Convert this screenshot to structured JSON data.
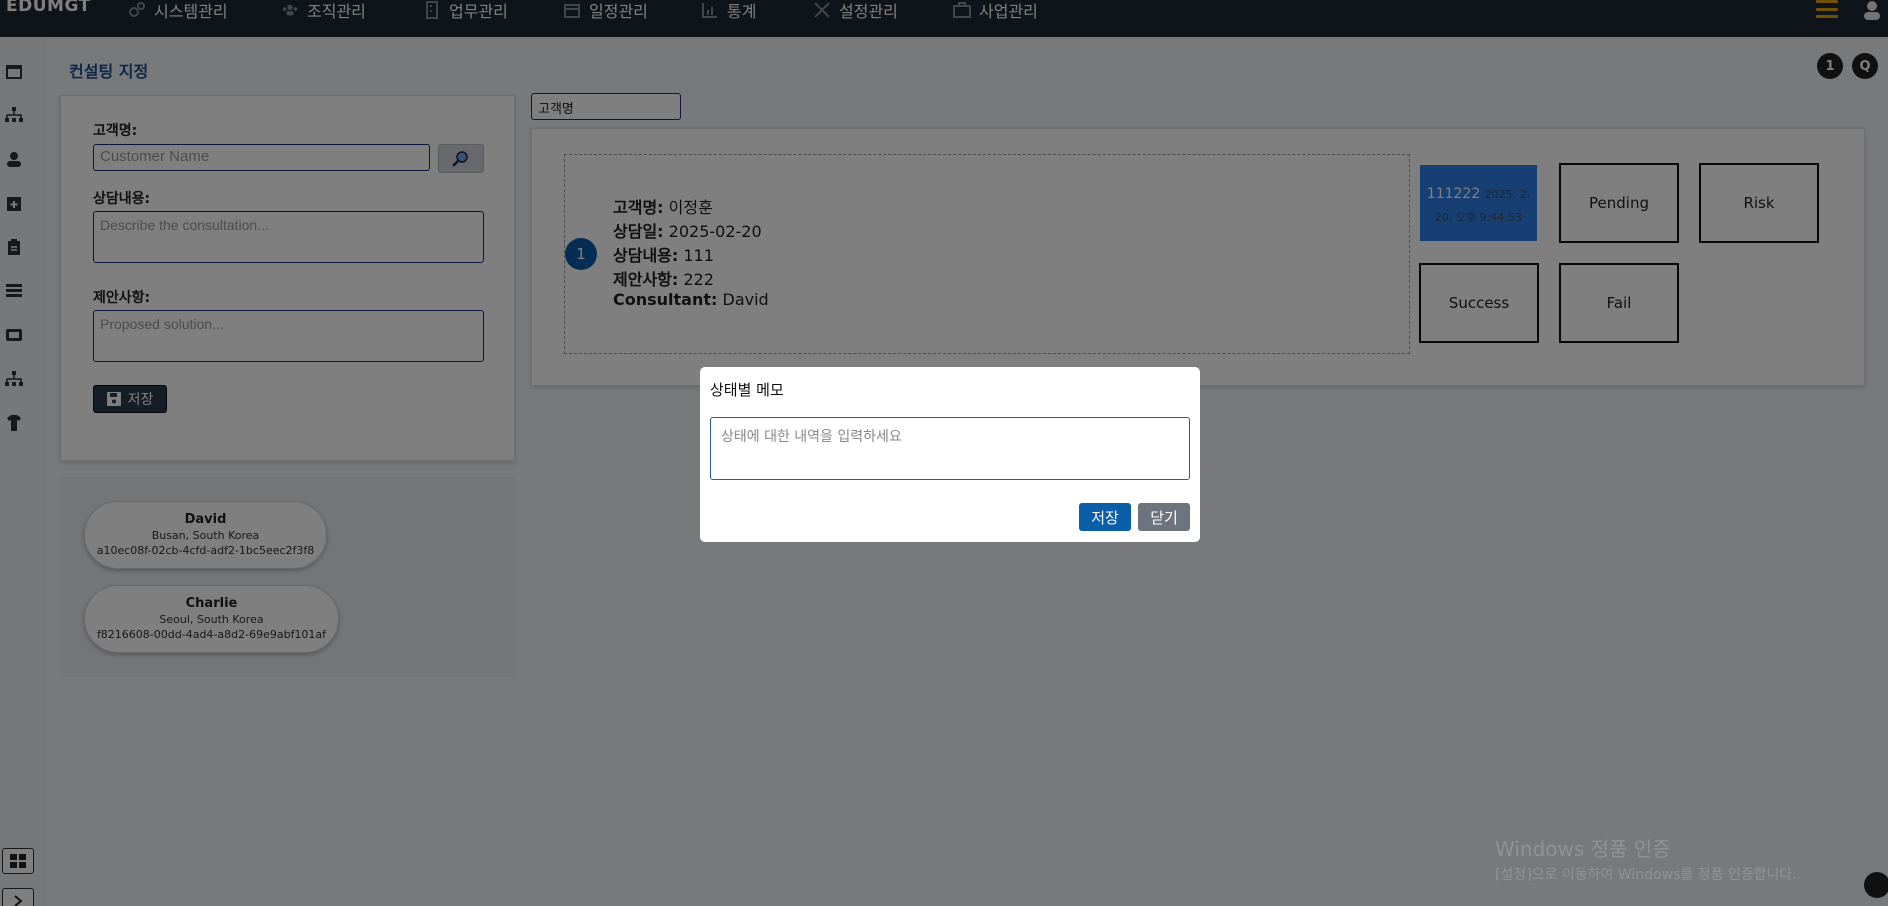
{
  "app": {
    "brand": "EDUMGT"
  },
  "nav": [
    {
      "label": "시스템관리",
      "icon": "gears-icon"
    },
    {
      "label": "조직관리",
      "icon": "users-icon"
    },
    {
      "label": "업무관리",
      "icon": "building-icon"
    },
    {
      "label": "일정관리",
      "icon": "calendar-icon"
    },
    {
      "label": "통계",
      "icon": "chart-icon"
    },
    {
      "label": "설정관리",
      "icon": "tools-icon"
    },
    {
      "label": "사업관리",
      "icon": "briefcase-icon"
    }
  ],
  "page": {
    "title": "컨설팅 지정",
    "help_button": "1",
    "q_button": "Q"
  },
  "form": {
    "customer_label": "고객명:",
    "customer_placeholder": "Customer Name",
    "consult_label": "상담내용:",
    "consult_placeholder": "Describe the consultation...",
    "proposal_label": "제안사항:",
    "proposal_placeholder": "Proposed solution...",
    "save_label": "저장"
  },
  "consultants": [
    {
      "name": "David",
      "location": "Busan, South Korea",
      "id": "a10ec08f-02cb-4cfd-adf2-1bc5eec2f3f8"
    },
    {
      "name": "Charlie",
      "location": "Seoul, South Korea",
      "id": "f8216608-00dd-4ad4-a8d2-69e9abf101af"
    }
  ],
  "filter": {
    "customer_value": "고객명"
  },
  "record": {
    "number": "1",
    "customer_key": "고객명:",
    "customer_val": " 이정훈",
    "date_key": "상담일:",
    "date_val": " 2025-02-20",
    "content_key": "상담내용:",
    "content_val": " 111",
    "proposal_key": "제안사항:",
    "proposal_val": " 222",
    "consultant_key": "Consultant:",
    "consultant_val": " David"
  },
  "statuses": {
    "active_text": "111222",
    "active_time": "2025. 2. 20. 오후 9:44:53",
    "pending": "Pending",
    "risk": "Risk",
    "success": "Success",
    "fail": "Fail"
  },
  "modal": {
    "title": "상태별 메모",
    "placeholder": "상태에 대한 내역을 입력하세요",
    "save": "저장",
    "close": "닫기"
  },
  "watermark": {
    "title": "Windows 정품 인증",
    "subtitle": "[설정]으로 이동하여 Windows를 정품 인증합니다."
  },
  "colors": {
    "nav_bg": "#1f2734",
    "accent": "#0d5aa8",
    "status_active": "#2f7ee6",
    "hamburger": "#e2a400"
  }
}
